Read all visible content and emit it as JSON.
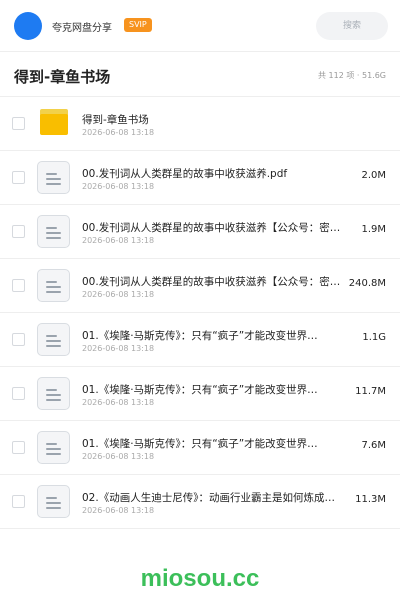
{
  "header": {
    "username": "夸克网盘分享",
    "badge": "SVIP",
    "search_placeholder": "搜索"
  },
  "titlebar": {
    "title": "得到-章鱼书场",
    "stats": "共 112 项 · 51.6G"
  },
  "files": [
    {
      "type": "folder",
      "name": "得到-章鱼书场",
      "date": "2026-06-08 13:18",
      "size": ""
    },
    {
      "type": "file",
      "name": "00.发刊词从人类群星的故事中收获滋养.pdf",
      "date": "2026-06-08 13:18",
      "size": "2.0M"
    },
    {
      "type": "file",
      "name": "00.发刊词从人类群星的故事中收获滋养【公众号：密…",
      "date": "2026-06-08 13:18",
      "size": "1.9M"
    },
    {
      "type": "file",
      "name": "00.发刊词从人类群星的故事中收获滋养【公众号：密…",
      "date": "2026-06-08 13:18",
      "size": "240.8M"
    },
    {
      "type": "file",
      "name": "01.《埃隆·马斯克传》：只有“疯子”才能改变世界…",
      "date": "2026-06-08 13:18",
      "size": "1.1G"
    },
    {
      "type": "file",
      "name": "01.《埃隆·马斯克传》：只有“疯子”才能改变世界…",
      "date": "2026-06-08 13:18",
      "size": "11.7M"
    },
    {
      "type": "file",
      "name": "01.《埃隆·马斯克传》：只有“疯子”才能改变世界…",
      "date": "2026-06-08 13:18",
      "size": "7.6M"
    },
    {
      "type": "file",
      "name": "02.《动画人生迪士尼传》：动画行业霸主是如何炼成…",
      "date": "2026-06-08 13:18",
      "size": "11.3M"
    }
  ],
  "watermark": "miosou.cc",
  "colors": {
    "accent": "#1e7bf2",
    "badge": "#f7931e",
    "folder": "#f9be00",
    "watermark": "#3cbf5a"
  },
  "icons": {
    "folder": "folder-icon",
    "file": "document-icon"
  }
}
